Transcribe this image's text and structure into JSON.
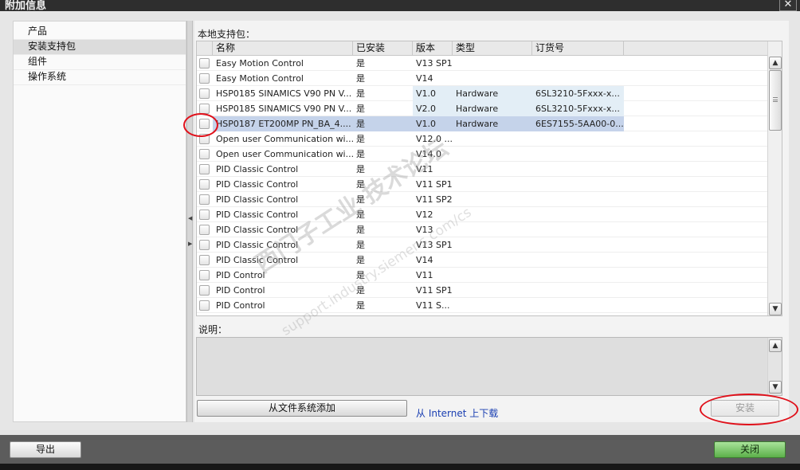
{
  "window": {
    "title": "附加信息",
    "close_glyph": "✕"
  },
  "nav": {
    "items": [
      {
        "label": "产品"
      },
      {
        "label": "安装支持包"
      },
      {
        "label": "组件"
      },
      {
        "label": "操作系统"
      }
    ],
    "selected": "安装支持包"
  },
  "packages": {
    "section_label": "本地支持包：",
    "columns": {
      "name": "名称",
      "installed": "已安装",
      "version": "版本",
      "type": "类型",
      "order": "订货号"
    },
    "rows": [
      {
        "name": "Easy Motion Control",
        "installed": "是",
        "version": "V13 SP1",
        "type": "",
        "order": ""
      },
      {
        "name": "Easy Motion Control",
        "installed": "是",
        "version": "V14",
        "type": "",
        "order": ""
      },
      {
        "name": "HSP0185 SINAMICS V90 PN V...",
        "installed": "是",
        "version": "V1.0",
        "type": "Hardware",
        "order": "6SL3210-5Fxxx-x..."
      },
      {
        "name": "HSP0185 SINAMICS V90 PN V...",
        "installed": "是",
        "version": "V2.0",
        "type": "Hardware",
        "order": "6SL3210-5Fxxx-x..."
      },
      {
        "name": "HSP0187 ET200MP PN_BA_4....",
        "installed": "是",
        "version": "V1.0",
        "type": "Hardware",
        "order": "6ES7155-5AA00-0..."
      },
      {
        "name": "Open user Communication wi...",
        "installed": "是",
        "version": "V12.0 ...",
        "type": "",
        "order": ""
      },
      {
        "name": "Open user Communication wi...",
        "installed": "是",
        "version": "V14.0",
        "type": "",
        "order": ""
      },
      {
        "name": "PID Classic Control",
        "installed": "是",
        "version": "V11",
        "type": "",
        "order": ""
      },
      {
        "name": "PID Classic Control",
        "installed": "是",
        "version": "V11 SP1",
        "type": "",
        "order": ""
      },
      {
        "name": "PID Classic Control",
        "installed": "是",
        "version": "V11 SP2",
        "type": "",
        "order": ""
      },
      {
        "name": "PID Classic Control",
        "installed": "是",
        "version": "V12",
        "type": "",
        "order": ""
      },
      {
        "name": "PID Classic Control",
        "installed": "是",
        "version": "V13",
        "type": "",
        "order": ""
      },
      {
        "name": "PID Classic Control",
        "installed": "是",
        "version": "V13 SP1",
        "type": "",
        "order": ""
      },
      {
        "name": "PID Classic Control",
        "installed": "是",
        "version": "V14",
        "type": "",
        "order": ""
      },
      {
        "name": "PID Control",
        "installed": "是",
        "version": "V11",
        "type": "",
        "order": ""
      },
      {
        "name": "PID Control",
        "installed": "是",
        "version": "V11 SP1",
        "type": "",
        "order": ""
      },
      {
        "name": "PID Control",
        "installed": "是",
        "version": "V11 S...",
        "type": "",
        "order": ""
      }
    ],
    "highlighted_rows": [
      2,
      3
    ],
    "selected_row": 4
  },
  "description": {
    "label": "说明：",
    "text": ""
  },
  "actions": {
    "add_from_fs": "从文件系统添加",
    "download_link": "从 Internet 上下载",
    "install": "安装",
    "export": "导出",
    "close": "关闭"
  },
  "watermark": {
    "main": "西门子工业  技术论坛",
    "url": "support.industry.siemens.com/cs"
  },
  "colors": {
    "accent_green": "#5cb04a",
    "selection": "#c5d3ea",
    "hover": "#e3eef6",
    "link": "#1a3fb2",
    "annotation": "#e0101a"
  }
}
